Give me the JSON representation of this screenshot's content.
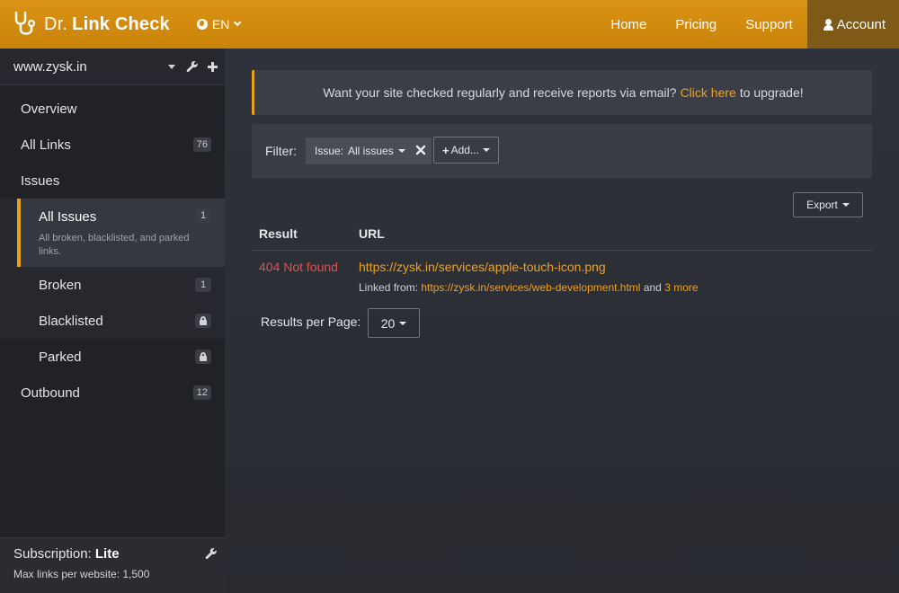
{
  "header": {
    "brand_prefix": "Dr.",
    "brand_name": "Link Check",
    "language": "EN",
    "nav": {
      "home": "Home",
      "pricing": "Pricing",
      "support": "Support",
      "account": "Account"
    },
    "colors": {
      "bar": "#d08b10",
      "account_bg": "#7e5a16"
    }
  },
  "sidebar": {
    "site": "www.zysk.in",
    "items": {
      "overview": "Overview",
      "all_links": {
        "label": "All Links",
        "count": "76"
      },
      "issues": "Issues",
      "all_issues": {
        "label": "All Issues",
        "count": "1",
        "description": "All broken, blacklisted, and parked links."
      },
      "broken": {
        "label": "Broken",
        "count": "1"
      },
      "blacklisted": {
        "label": "Blacklisted",
        "icon": "lock-icon"
      },
      "parked": {
        "label": "Parked",
        "icon": "lock-icon"
      },
      "outbound": {
        "label": "Outbound",
        "count": "12"
      }
    },
    "subscription": {
      "label": "Subscription:",
      "plan": "Lite",
      "max_links": "Max links per website: 1,500"
    }
  },
  "main": {
    "banner": {
      "text_before": "Want your site checked regularly and receive reports via email?",
      "link": "Click here",
      "text_after": "to upgrade!"
    },
    "filter": {
      "label": "Filter:",
      "chip_key": "Issue:",
      "chip_value": "All issues",
      "add_label": "Add..."
    },
    "export_label": "Export",
    "table": {
      "headers": {
        "result": "Result",
        "url": "URL"
      },
      "rows": [
        {
          "result": "404 Not found",
          "url": "https://zysk.in/services/apple-touch-icon.png",
          "linked_from_label": "Linked from:",
          "linked_from_url": "https://zysk.in/services/web-development.html",
          "and": "and",
          "more": "3 more"
        }
      ]
    },
    "results_per_page": {
      "label": "Results per Page:",
      "value": "20"
    },
    "colors": {
      "accent": "#f0a020",
      "error": "#d9534f"
    }
  }
}
